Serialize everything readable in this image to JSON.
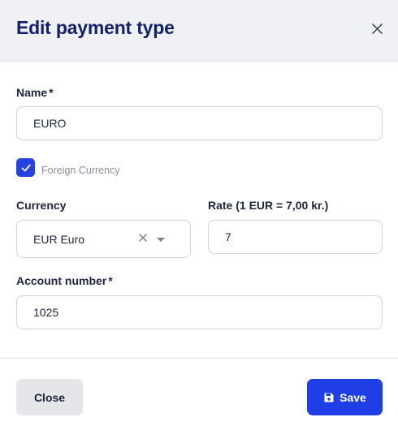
{
  "dialog": {
    "title": "Edit payment type"
  },
  "form": {
    "name": {
      "label": "Name",
      "required_mark": "*",
      "value": "EURO"
    },
    "foreign_currency": {
      "label": "Foreign Currency",
      "checked": true
    },
    "currency": {
      "label": "Currency",
      "value": "EUR Euro"
    },
    "rate": {
      "label": "Rate (1 EUR = 7,00 kr.)",
      "value": "7"
    },
    "account_number": {
      "label": "Account number",
      "required_mark": "*",
      "value": "1025"
    }
  },
  "footer": {
    "close_label": "Close",
    "save_label": "Save"
  },
  "colors": {
    "primary": "#1f3ee6",
    "title": "#14206b",
    "header_bg": "#f0f1f4"
  },
  "icons": {
    "close": "close-icon",
    "check": "checkmark-icon",
    "clear": "clear-icon",
    "dropdown": "chevron-down-icon",
    "save": "floppy-disk-icon"
  }
}
